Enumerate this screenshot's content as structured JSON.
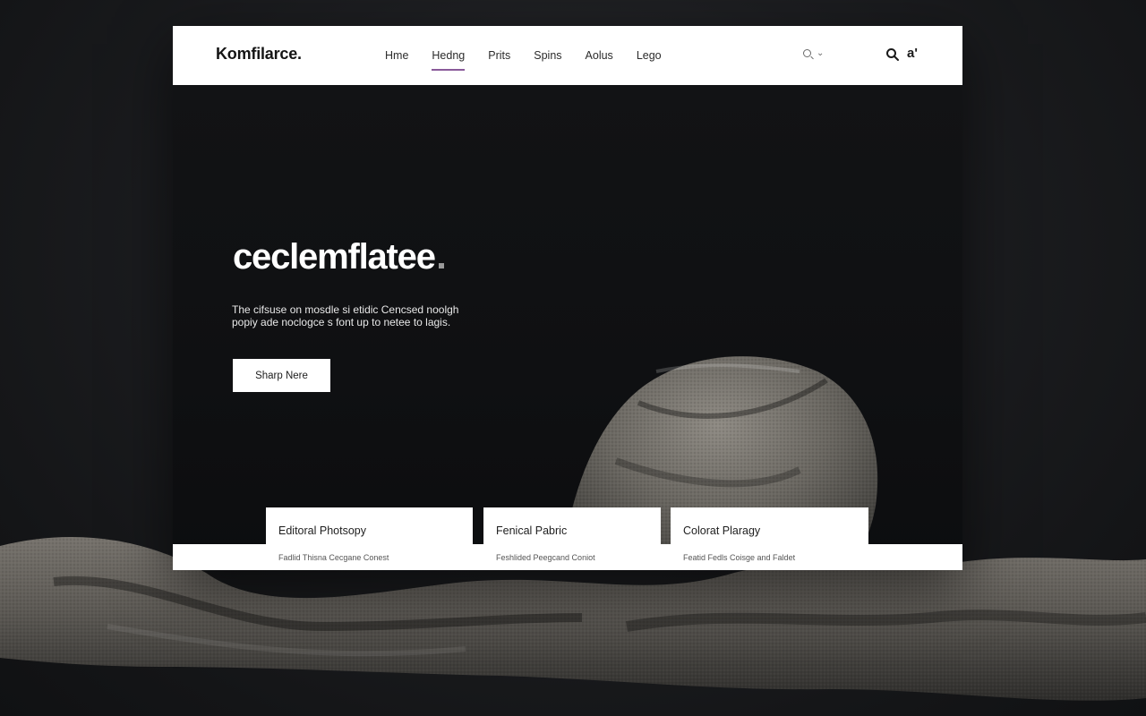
{
  "brand": {
    "name": "Komfilarce."
  },
  "nav": {
    "items": [
      {
        "label": "Hme"
      },
      {
        "label": "Hedng"
      },
      {
        "label": "Prits"
      },
      {
        "label": "Spins"
      },
      {
        "label": "Aolus"
      },
      {
        "label": "Lego"
      }
    ],
    "active_index": 1,
    "active_color": "#8a5a9a",
    "lang_selector": {
      "chevron": "⌄"
    },
    "account_label": "a'"
  },
  "hero": {
    "title": "ceclemflatee",
    "description": "The cifsuse on mosdle si etidic Cencsed noolgh popiy ade noclogce s font up to netee to lagis.",
    "cta_label": "Sharp Nere"
  },
  "cards": [
    {
      "title": "Editoral Photsopy",
      "subtitle": "Fadlid Thisna Cecgane Conest"
    },
    {
      "title": "Fenical Pabric",
      "subtitle": "Feshlided Peegcand Coniot"
    },
    {
      "title": "Colorat Plaragy",
      "subtitle": "Featid Fedls Coisge and Faldet"
    }
  ],
  "colors": {
    "background": "#18191b",
    "nav_bg": "#ffffff",
    "hero_bg": "#101113",
    "text_light": "#ffffff",
    "fabric": "#6e6b66"
  }
}
